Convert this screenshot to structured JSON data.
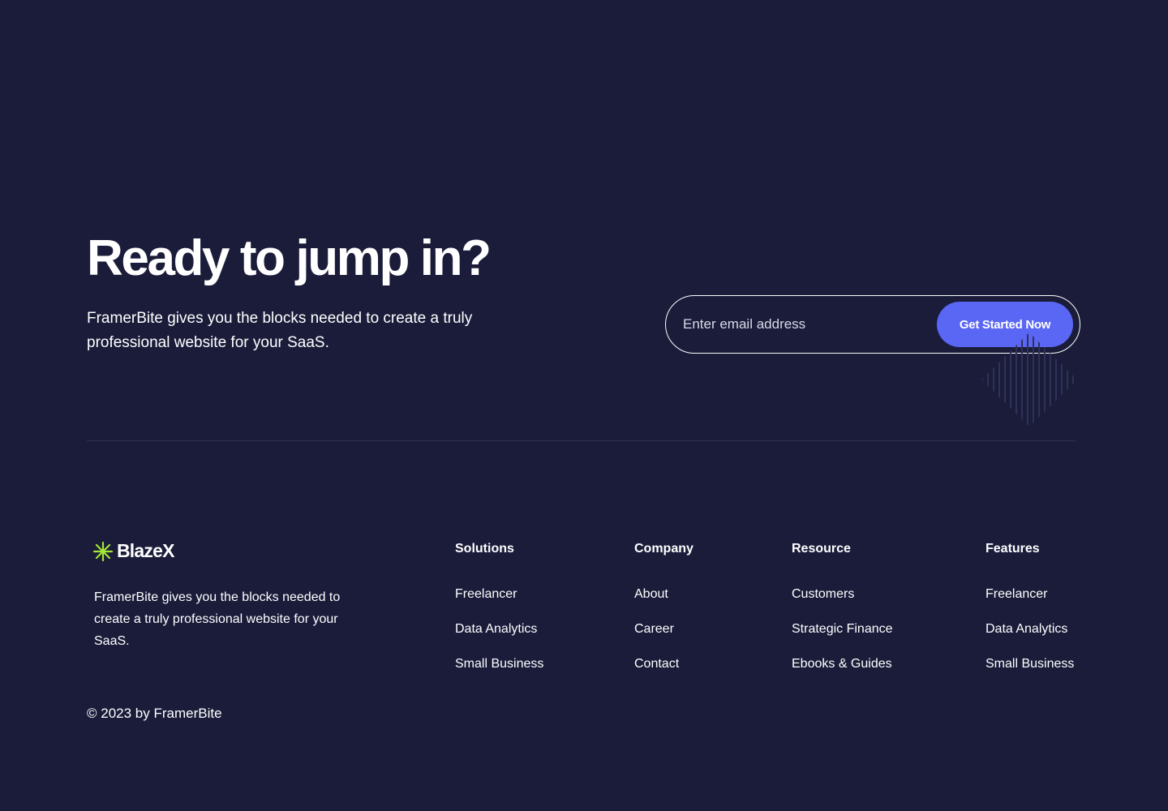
{
  "cta": {
    "title": "Ready to jump in?",
    "subtitle": "FramerBite gives you the blocks needed to create a truly professional website for your SaaS.",
    "email_placeholder": "Enter email address",
    "button_label": "Get Started Now"
  },
  "brand": {
    "name": "BlazeX",
    "icon": "asterisk-icon",
    "description": "FramerBite gives you the blocks needed to create a truly professional website for your SaaS."
  },
  "footer": {
    "columns": [
      {
        "heading": "Solutions",
        "links": [
          "Freelancer",
          "Data Analytics",
          "Small Business"
        ]
      },
      {
        "heading": "Company",
        "links": [
          "About",
          "Career",
          "Contact"
        ]
      },
      {
        "heading": "Resource",
        "links": [
          "Customers",
          "Strategic Finance",
          "Ebooks & Guides"
        ]
      },
      {
        "heading": "Features",
        "links": [
          "Freelancer",
          "Data Analytics",
          "Small Business"
        ]
      }
    ],
    "copyright": "© 2023 by FramerBite"
  },
  "colors": {
    "background": "#1a1c3a",
    "accent": "#5a66f4",
    "brand_icon": "#a3e635",
    "text": "#ffffff",
    "divider": "#2c2f52"
  }
}
